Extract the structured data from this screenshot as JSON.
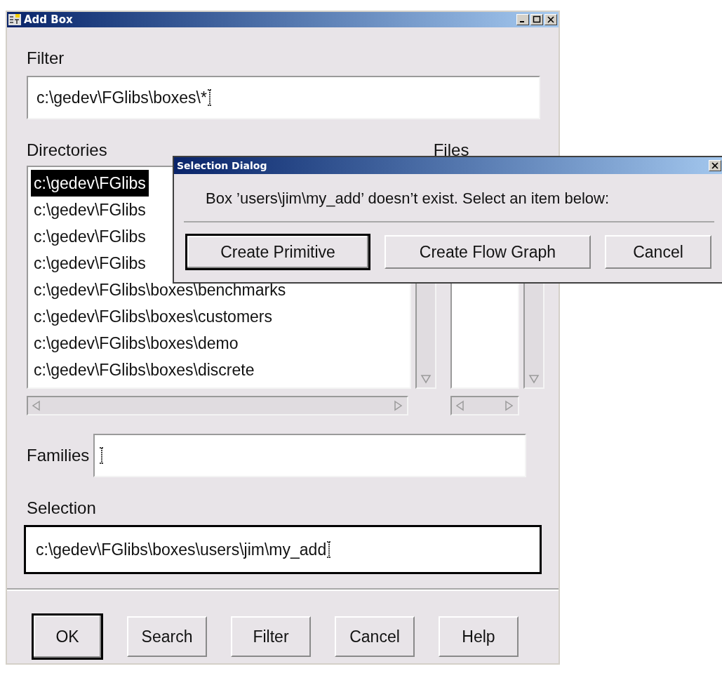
{
  "window": {
    "title": "Add Box"
  },
  "filter": {
    "label": "Filter",
    "value": "c:\\gedev\\FGlibs\\boxes\\*"
  },
  "directories": {
    "label": "Directories",
    "items": [
      {
        "text": "c:\\gedev\\FGlibs",
        "selected": true
      },
      {
        "text": "c:\\gedev\\FGlibs",
        "selected": false
      },
      {
        "text": "c:\\gedev\\FGlibs",
        "selected": false
      },
      {
        "text": "c:\\gedev\\FGlibs",
        "selected": false
      },
      {
        "text": "c:\\gedev\\FGlibs\\boxes\\benchmarks",
        "selected": false
      },
      {
        "text": "c:\\gedev\\FGlibs\\boxes\\customers",
        "selected": false
      },
      {
        "text": "c:\\gedev\\FGlibs\\boxes\\demo",
        "selected": false
      },
      {
        "text": "c:\\gedev\\FGlibs\\boxes\\discrete",
        "selected": false
      }
    ]
  },
  "files": {
    "label": "Files"
  },
  "families": {
    "label": "Families"
  },
  "selection": {
    "label": "Selection",
    "value": "c:\\gedev\\FGlibs\\boxes\\users\\jim\\my_add",
    "focused": true
  },
  "buttons": [
    {
      "label": "OK",
      "default": true
    },
    {
      "label": "Search",
      "default": false
    },
    {
      "label": "Filter",
      "default": false
    },
    {
      "label": "Cancel",
      "default": false
    },
    {
      "label": "Help",
      "default": false
    }
  ],
  "dialog": {
    "title": "Selection Dialog",
    "message": "Box ’users\\jim\\my_add’ doesn’t exist. Select an item below:",
    "buttons": [
      {
        "label": "Create Primitive",
        "default": true
      },
      {
        "label": "Create Flow Graph",
        "default": false
      },
      {
        "label": "Cancel",
        "default": false
      }
    ]
  }
}
